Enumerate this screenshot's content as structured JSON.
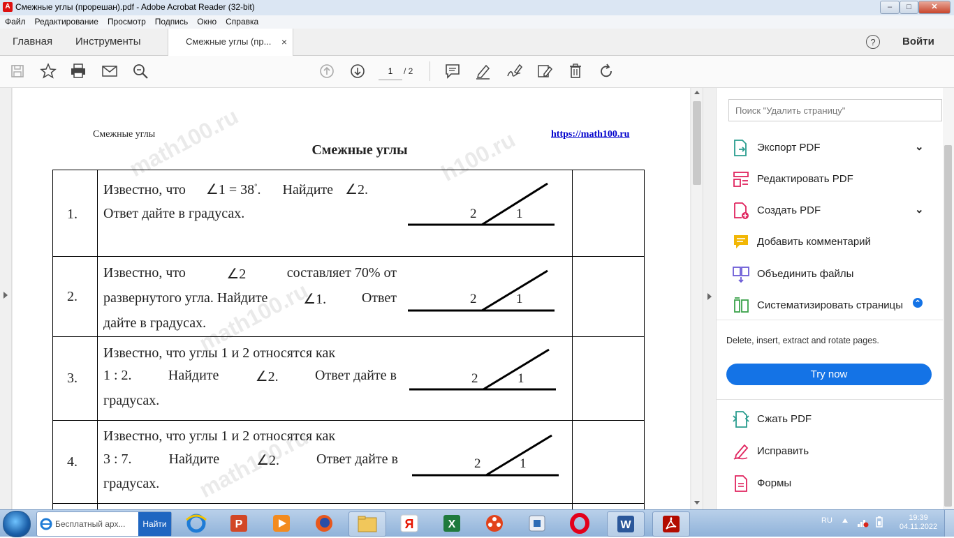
{
  "window": {
    "title": "Смежные углы (прорешан).pdf - Adobe Acrobat Reader (32-bit)",
    "controls": [
      "–",
      "□",
      "✕"
    ]
  },
  "menu": [
    "Файл",
    "Редактирование",
    "Просмотр",
    "Подпись",
    "Окно",
    "Справка"
  ],
  "tabs": {
    "home": "Главная",
    "tools": "Инструменты",
    "doc": "Смежные углы (пр...",
    "close": "×",
    "help": "?",
    "signin": "Войти"
  },
  "toolbar": {
    "page_current": "1",
    "page_total": "/ 2",
    "icons": [
      "save-icon",
      "star-icon",
      "print-icon",
      "mail-icon",
      "zoom-search-icon",
      "page-up-icon",
      "page-down-icon",
      "comment-icon",
      "highlight-pen-icon",
      "sign-icon",
      "edit-pdf-icon",
      "delete-icon",
      "rotate-icon"
    ]
  },
  "document": {
    "header_left": "Смежные углы",
    "header_right": "https://math100.ru",
    "title": "Смежные углы",
    "watermarks": [
      "math100.ru",
      "h100.ru",
      "math100.ru",
      "math100.ru"
    ],
    "problems": [
      {
        "num": "1.",
        "line1": "Известно,  что",
        "angle1": "∠1 = 38",
        "deg": "°",
        "dot": ".",
        "find": "Найдите",
        "angle2": "∠2.",
        "line2": "Ответ дайте в градусах.",
        "lbl_left": "2",
        "lbl_right": "1"
      },
      {
        "num": "2.",
        "line1a": "Известно,  что",
        "angle": "∠2",
        "line1b": "составляет  70%  от",
        "line2a": "развернутого угла. Найдите",
        "angle_b": "∠1.",
        "line2b": "Ответ",
        "line3": "дайте в градусах.",
        "lbl_left": "2",
        "lbl_right": "1"
      },
      {
        "num": "3.",
        "line1": "Известно,  что  углы  1  и  2  относятся  как",
        "ratio": "1 : 2.",
        "find": "Найдите",
        "angle": "∠2.",
        "rest": "Ответ  дайте  в",
        "line3": "градусах.",
        "lbl_left": "2",
        "lbl_right": "1"
      },
      {
        "num": "4.",
        "line1": "Известно,  что  углы  1  и  2  относятся  как",
        "ratio": "3 : 7.",
        "find": "Найдите",
        "angle": "∠2.",
        "rest": "Ответ  дайте  в",
        "line3": "градусах.",
        "lbl_left": "2",
        "lbl_right": "1"
      }
    ]
  },
  "right_pane": {
    "search_placeholder": "Поиск \"Удалить страницу\"",
    "tools": [
      {
        "label": "Экспорт PDF",
        "icon": "export-pdf-icon",
        "color": "#2a9d8f",
        "chevron": "⌄"
      },
      {
        "label": "Редактировать PDF",
        "icon": "edit-pdf-icon",
        "color": "#e0245e"
      },
      {
        "label": "Создать PDF",
        "icon": "create-pdf-icon",
        "color": "#e0245e",
        "chevron": "⌄"
      },
      {
        "label": "Добавить комментарий",
        "icon": "comment-icon",
        "color": "#f2b705"
      },
      {
        "label": "Объединить файлы",
        "icon": "combine-files-icon",
        "color": "#6b5bd6"
      },
      {
        "label": "Систематизировать страницы",
        "icon": "organize-pages-icon",
        "color": "#3aa24a",
        "chevron": "⌃"
      }
    ],
    "promo_text": "Delete, insert, extract and rotate pages.",
    "try_now": "Try now",
    "more_tools": [
      {
        "label": "Сжать PDF",
        "icon": "compress-pdf-icon",
        "color": "#2a9d8f"
      },
      {
        "label": "Исправить",
        "icon": "fill-sign-icon",
        "color": "#e0245e"
      },
      {
        "label": "Формы",
        "icon": "forms-icon",
        "color": "#e0245e"
      }
    ]
  },
  "taskbar": {
    "ie_task_label": "Бесплатный арх...",
    "ie_task_button": "Найти",
    "lang": "RU",
    "time": "19:39",
    "date": "04.11.2022",
    "apps": [
      "ie-icon",
      "powerpoint-icon",
      "media-player-icon",
      "firefox-icon",
      "file-explorer-icon",
      "yandex-icon",
      "excel-icon",
      "video-app-icon",
      "usb-app-icon",
      "opera-icon",
      "word-icon",
      "acrobat-icon"
    ]
  },
  "colors": {
    "accent": "#1473e6",
    "title_bar": "#dbe6f3",
    "taskbar": "#9fbfe3"
  }
}
